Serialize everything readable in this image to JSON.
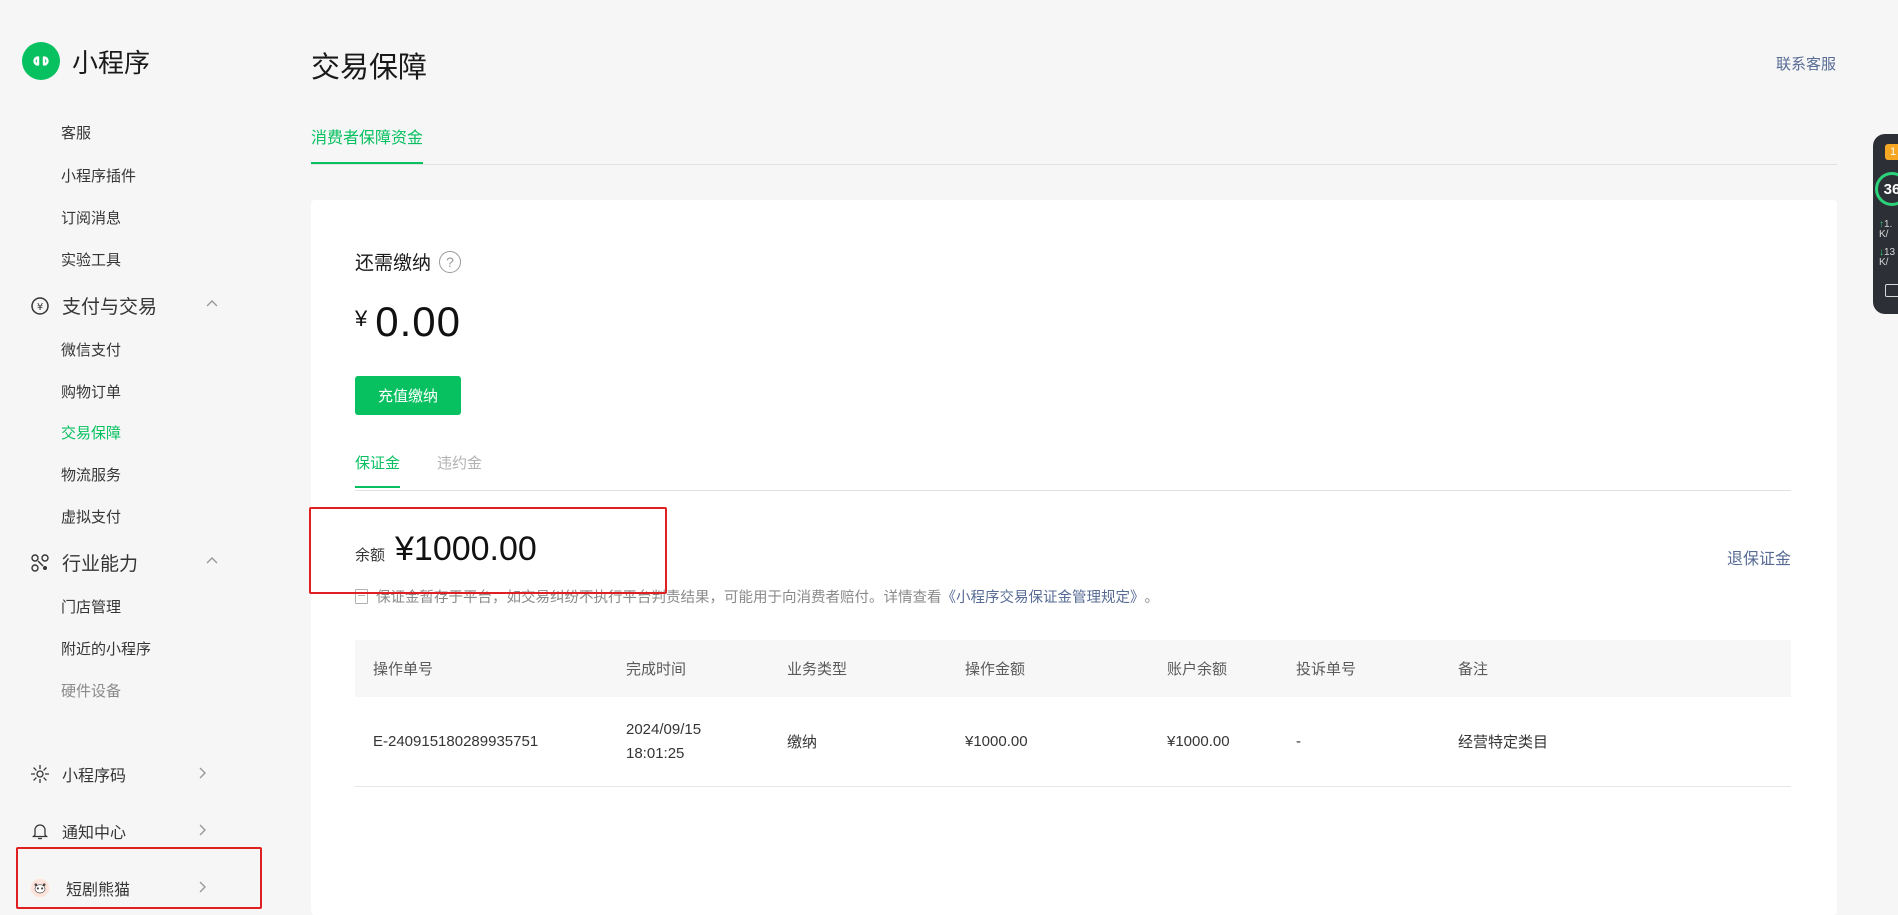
{
  "app": {
    "title": "小程序",
    "accent": "#07c160",
    "link_color": "#576b95"
  },
  "sidebar": {
    "items_top": [
      "客服",
      "小程序插件",
      "订阅消息",
      "实验工具"
    ],
    "group_pay": {
      "label": "支付与交易",
      "icon": "yuan-circle-icon"
    },
    "items_pay": [
      "微信支付",
      "购物订单",
      "交易保障",
      "物流服务",
      "虚拟支付"
    ],
    "group_industry": {
      "label": "行业能力",
      "icon": "industry-nodes-icon"
    },
    "items_industry": [
      "门店管理",
      "附近的小程序",
      "硬件设备"
    ],
    "bottom": [
      {
        "label": "小程序码",
        "icon": "qrcode-sun-icon"
      },
      {
        "label": "通知中心",
        "icon": "bell-icon"
      },
      {
        "label": "短剧熊猫",
        "icon": "panda-avatar-icon"
      }
    ]
  },
  "header": {
    "title": "交易保障",
    "contact": "联系客服"
  },
  "tabs": {
    "main": "消费者保障资金"
  },
  "due": {
    "label": "还需缴纳",
    "currency": "¥",
    "amount": "0.00",
    "button": "充值缴纳"
  },
  "subtabs": {
    "deposit": "保证金",
    "penalty": "违约金"
  },
  "balance": {
    "label": "余额",
    "value": "¥1000.00",
    "refund": "退保证金"
  },
  "note": {
    "text": "保证金暂存于平台，如交易纠纷不执行平台判责结果，可能用于向消费者赔付。详情查看",
    "link": "《小程序交易保证金管理规定》",
    "end": "。"
  },
  "table": {
    "headers": [
      "操作单号",
      "完成时间",
      "业务类型",
      "操作金额",
      "账户余额",
      "投诉单号",
      "备注"
    ],
    "rows": [
      {
        "order": "E-240915180289935751",
        "date": "2024/09/15",
        "time": "18:01:25",
        "type": "缴纳",
        "amount": "¥1000.00",
        "balance": "¥1000.00",
        "complaint": "-",
        "remark": "经营特定类目"
      }
    ]
  },
  "widget": {
    "badge": "1",
    "score": "36",
    "up": "1.",
    "up_unit": "K/",
    "down": "13",
    "down_unit": "K/"
  }
}
